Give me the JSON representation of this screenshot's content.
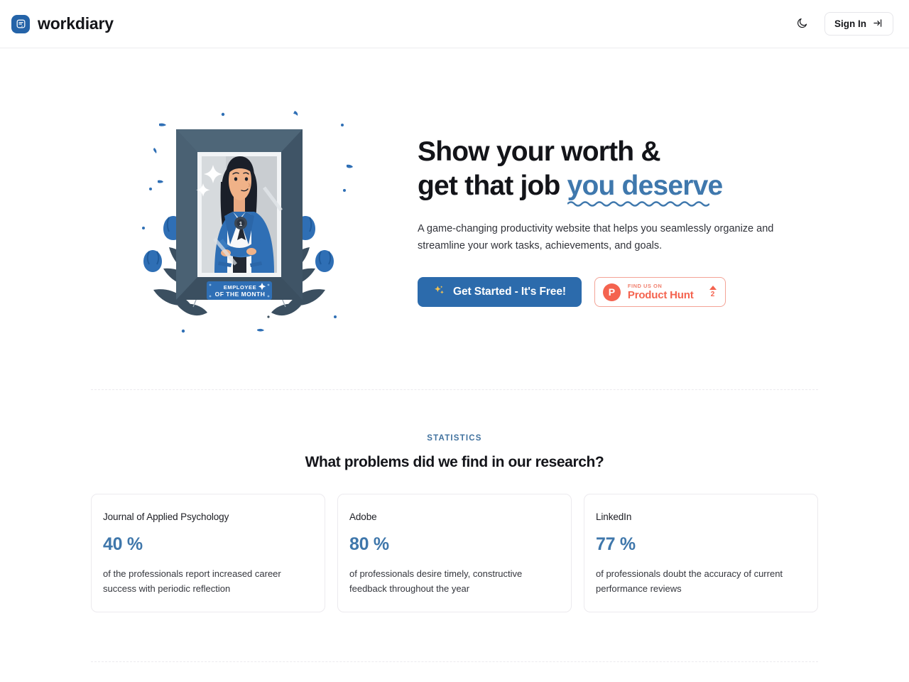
{
  "header": {
    "brand_name": "workdiary",
    "brand_icon": "note-document-icon",
    "theme_toggle_icon": "moon-icon",
    "signin_label": "Sign In",
    "signin_icon": "login-arrow-icon"
  },
  "hero": {
    "title_line1": "Show your worth &",
    "title_line2_plain": "get that job ",
    "title_line2_highlight": "you deserve",
    "subtitle": "A game-changing productivity website that helps you seamlessly organize and streamline your work tasks, achievements, and goals.",
    "cta_label": "Get Started - It's Free!",
    "cta_icon": "sparkles-icon",
    "product_hunt": {
      "logo_letter": "P",
      "kicker": "FIND US ON",
      "name": "Product Hunt",
      "vote_count": "2",
      "vote_icon": "upvote-caret-icon"
    },
    "illustration": {
      "name": "employee-of-the-month-frame-illustration",
      "plaque_line1": "EMPLOYEE",
      "plaque_line2": "OF THE MONTH",
      "medal_number": "1"
    }
  },
  "statistics": {
    "kicker": "STATISTICS",
    "title": "What problems did we find in our research?",
    "cards": [
      {
        "source": "Journal of Applied Psychology",
        "value": "40 %",
        "description": "of the professionals report increased career success with periodic reflection"
      },
      {
        "source": "Adobe",
        "value": "80 %",
        "description": "of professionals desire timely, constructive feedback throughout the year"
      },
      {
        "source": "LinkedIn",
        "value": "77 %",
        "description": "of professionals doubt the accuracy of current performance reviews"
      }
    ]
  },
  "colors": {
    "brand_blue": "#2463a8",
    "cta_blue": "#2c6bac",
    "stat_blue": "#3f77ab",
    "kicker_blue": "#41729f",
    "product_hunt_orange": "#f4634f",
    "divider": "#eceaee",
    "page_background": "#ffffff"
  }
}
